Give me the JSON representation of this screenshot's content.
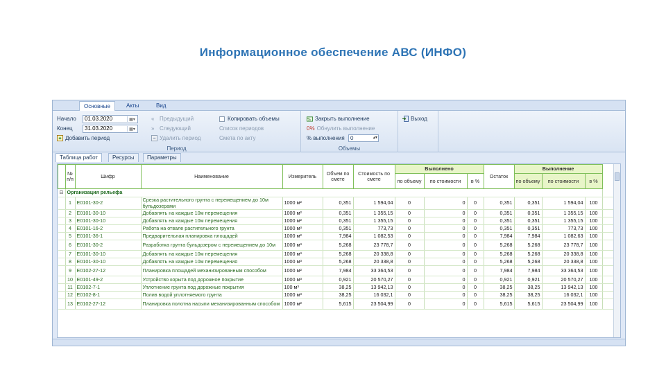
{
  "slide": {
    "title": "Информационное обеспечение АВС (ИНФО)"
  },
  "ribbon_tabs": [
    "Основные",
    "Акты",
    "Вид"
  ],
  "period_group": {
    "start_label": "Начало",
    "start_value": "01.03.2020",
    "end_label": "Конец",
    "end_value": "31.03.2020",
    "add_period": "Добавить период",
    "prev": "Предыдущий",
    "next": "Следующий",
    "delete_period": "Удалить период",
    "copy_volumes": "Копировать объемы",
    "period_list": "Список периодов",
    "by_estimate": "Смета по акту",
    "label": "Период"
  },
  "volumes_group": {
    "close_completion": "Закрыть выполнение",
    "reset_completion": "Обнулить выполнение",
    "percent_label": "% выполнения",
    "percent_value": "0",
    "zero_pct": "0%",
    "label": "Объемы"
  },
  "exit_label": "Выход",
  "doc_tabs": [
    "Таблица работ",
    "Ресурсы",
    "Параметры"
  ],
  "grid": {
    "headers": {
      "num": "№ п/п",
      "code": "Шифр",
      "name": "Наименование",
      "unit": "Измеритель",
      "vol": "Объем по смете",
      "cost": "Стоимость по смете",
      "done": "Выполнено",
      "done_vol": "по объему",
      "done_cost": "по стоимости",
      "done_pct": "в %",
      "rest": "Остаток",
      "done2": "Выполнение",
      "done2_vol": "по объему",
      "done2_cost": "по стоимости",
      "done2_pct": "в %"
    },
    "group_title": "Организация рельефа",
    "rows": [
      {
        "n": "1",
        "code": "E0101-30-2",
        "name": "Срезка растительного грунта с перемещением до 10м бульдозерами",
        "unit": "1000 м²",
        "vol": "0,351",
        "cost": "1 594,04",
        "dv": "0",
        "dc": "0",
        "dp": "0",
        "rest": "0,351",
        "v2": "0,351",
        "c2": "1 594,04",
        "p2": "100"
      },
      {
        "n": "2",
        "code": "E0101-30-10",
        "name": "Добавлять на каждые 10м перемещения",
        "unit": "1000 м²",
        "vol": "0,351",
        "cost": "1 355,15",
        "dv": "0",
        "dc": "0",
        "dp": "0",
        "rest": "0,351",
        "v2": "0,351",
        "c2": "1 355,15",
        "p2": "100"
      },
      {
        "n": "3",
        "code": "E0101-30-10",
        "name": "Добавлять на каждые 10м перемещения",
        "unit": "1000 м²",
        "vol": "0,351",
        "cost": "1 355,15",
        "dv": "0",
        "dc": "0",
        "dp": "0",
        "rest": "0,351",
        "v2": "0,351",
        "c2": "1 355,15",
        "p2": "100"
      },
      {
        "n": "4",
        "code": "E0101-16-2",
        "name": "Работа на отвале растительного грунта",
        "unit": "1000 м³",
        "vol": "0,351",
        "cost": "773,73",
        "dv": "0",
        "dc": "0",
        "dp": "0",
        "rest": "0,351",
        "v2": "0,351",
        "c2": "773,73",
        "p2": "100"
      },
      {
        "n": "5",
        "code": "E0101-36-1",
        "name": "Предварительная планировка площадей",
        "unit": "1000 м²",
        "vol": "7,984",
        "cost": "1 082,53",
        "dv": "0",
        "dc": "0",
        "dp": "0",
        "rest": "7,984",
        "v2": "7,984",
        "c2": "1 082,63",
        "p2": "100"
      },
      {
        "n": "6",
        "code": "E0101-30-2",
        "name": "Разработка грунта бульдозером с перемещением до 10м",
        "unit": "1000 м³",
        "vol": "5,268",
        "cost": "23 778,7",
        "dv": "0",
        "dc": "0",
        "dp": "0",
        "rest": "5,268",
        "v2": "5,268",
        "c2": "23 778,7",
        "p2": "100"
      },
      {
        "n": "7",
        "code": "E0101-30-10",
        "name": "Добавлять на каждые 10м перемещения",
        "unit": "1000 м³",
        "vol": "5,268",
        "cost": "20 338,8",
        "dv": "0",
        "dc": "0",
        "dp": "0",
        "rest": "5,268",
        "v2": "5,268",
        "c2": "20 338,8",
        "p2": "100"
      },
      {
        "n": "8",
        "code": "E0101-30-10",
        "name": "Добавлять на каждые 10м перемещения",
        "unit": "1000 м³",
        "vol": "5,268",
        "cost": "20 338,8",
        "dv": "0",
        "dc": "0",
        "dp": "0",
        "rest": "5,268",
        "v2": "5,268",
        "c2": "20 338,8",
        "p2": "100"
      },
      {
        "n": "9",
        "code": "E0102-27-12",
        "name": "Планировка площадей механизированным способом",
        "unit": "1000 м²",
        "vol": "7,984",
        "cost": "33 364,53",
        "dv": "0",
        "dc": "0",
        "dp": "0",
        "rest": "7,984",
        "v2": "7,984",
        "c2": "33 364,53",
        "p2": "100"
      },
      {
        "n": "10",
        "code": "E0101-49-2",
        "name": "Устройство корыта под дорожное покрытие",
        "unit": "1000 м³",
        "vol": "0,921",
        "cost": "20 570,27",
        "dv": "0",
        "dc": "0",
        "dp": "0",
        "rest": "0,921",
        "v2": "0,921",
        "c2": "20 570,27",
        "p2": "100"
      },
      {
        "n": "11",
        "code": "E0102-7-1",
        "name": "Уплотнение грунта под дорожные покрытия",
        "unit": "100 м³",
        "vol": "38,25",
        "cost": "13 942,13",
        "dv": "0",
        "dc": "0",
        "dp": "0",
        "rest": "38,25",
        "v2": "38,25",
        "c2": "13 942,13",
        "p2": "100"
      },
      {
        "n": "12",
        "code": "E0102-8-1",
        "name": "Полив водой уплотняемого грунта",
        "unit": "1000 м³",
        "vol": "38,25",
        "cost": "16 032,1",
        "dv": "0",
        "dc": "0",
        "dp": "0",
        "rest": "38,25",
        "v2": "38,25",
        "c2": "16 032,1",
        "p2": "100"
      },
      {
        "n": "13",
        "code": "E0102-27-12",
        "name": "Планировка полотна насыпи механизированным способом",
        "unit": "1000 м²",
        "vol": "5,615",
        "cost": "23 504,99",
        "dv": "0",
        "dc": "0",
        "dp": "0",
        "rest": "5,615",
        "v2": "5,615",
        "c2": "23 504,99",
        "p2": "100"
      }
    ]
  }
}
